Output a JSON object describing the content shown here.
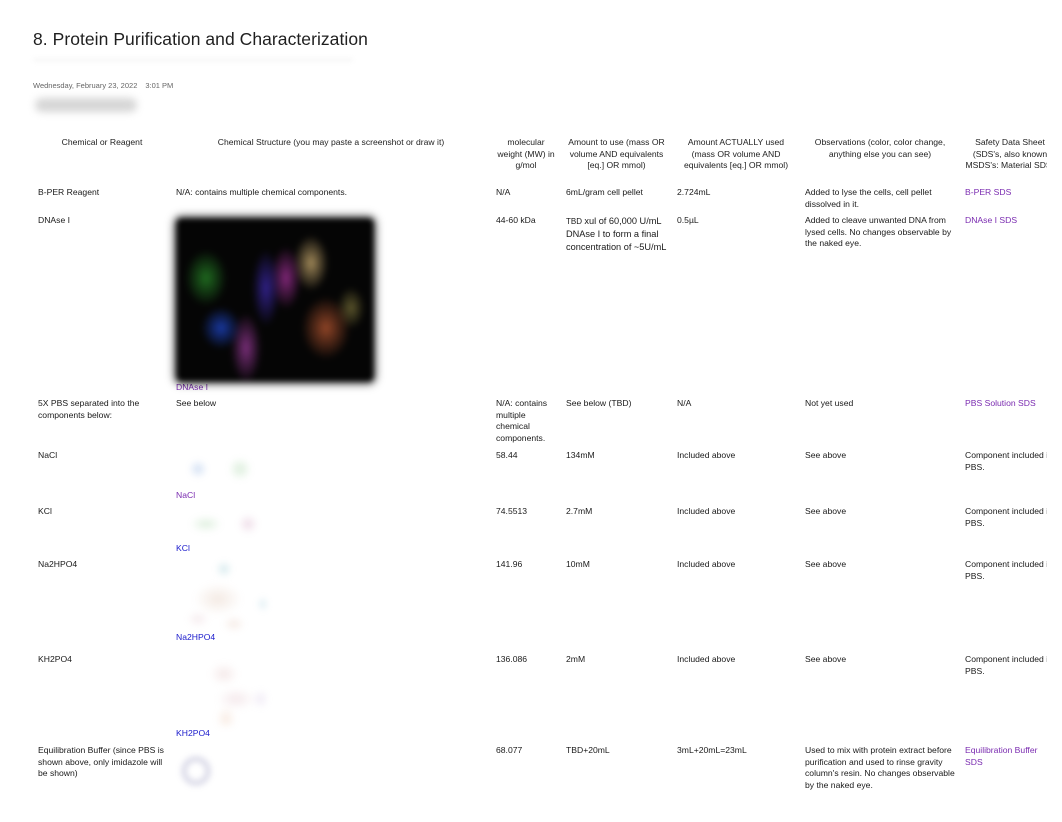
{
  "page": {
    "title": "8. Protein Purification and Characterization",
    "date": "Wednesday, February 23, 2022",
    "time": "3:01 PM"
  },
  "table": {
    "headers": [
      "Chemical or Reagent",
      "Chemical Structure (you may paste a screenshot or draw it)",
      "molecular weight (MW) in g/mol",
      "Amount to use (mass OR volume AND equivalents [eq.] OR mmol)",
      "Amount ACTUALLY used (mass OR volume AND equivalents [eq.] OR mmol)",
      "Observations (color, color change, anything else you can see)",
      "Safety Data Sheet (SDS's, also known MSDS's: Material SDS)"
    ],
    "rows": [
      {
        "reagent": "B-PER Reagent",
        "structure_text": "N/A: contains multiple chemical components.",
        "mw": "N/A",
        "amount_to_use": "6mL/gram cell pellet",
        "amount_used": "2.724mL",
        "observations": "Added to lyse the cells, cell pellet dissolved in it.",
        "sds": "B-PER SDS"
      },
      {
        "reagent": "DNAse I",
        "structure_image": "dnase-protein-structure",
        "structure_caption": "DNAse I",
        "mw": "44-60 kDa",
        "amount_to_use_prefix": "TBD",
        "amount_to_use": "xul of 60,000 U/mL DNAse I to form a final concentration of ~5U/mL",
        "amount_used": "0.5µL",
        "observations": "Added to cleave unwanted DNA from lysed cells. No changes observable by the naked eye.",
        "sds": "DNAse I SDS"
      },
      {
        "reagent": "5X PBS separated into the components below:",
        "structure_text": "See below",
        "mw": "N/A: contains multiple chemical components.",
        "amount_to_use": "See below (TBD)",
        "amount_used": "N/A",
        "observations": "Not yet used",
        "sds": "PBS Solution SDS"
      },
      {
        "reagent": "NaCl",
        "structure_image": "nacl-structure",
        "structure_caption": "NaCl",
        "mw": "58.44",
        "amount_to_use": "134mM",
        "amount_used": "Included above",
        "observations": "See above",
        "sds": "Component included in PBS."
      },
      {
        "reagent": "KCl",
        "structure_image": "kcl-structure",
        "structure_caption": "KCl",
        "mw": "74.5513",
        "amount_to_use": "2.7mM",
        "amount_used": "Included above",
        "observations": "See above",
        "sds": "Component included in PBS."
      },
      {
        "reagent": "Na2HPO4",
        "structure_image": "na2hpo4-structure",
        "structure_caption": "Na2HPO4",
        "mw": "141.96",
        "amount_to_use": "10mM",
        "amount_used": "Included above",
        "observations": "See above",
        "sds": "Component included in PBS."
      },
      {
        "reagent": "KH2PO4",
        "structure_image": "kh2po4-structure",
        "structure_caption": "KH2PO4",
        "mw": "136.086",
        "amount_to_use": "2mM",
        "amount_used": "Included above",
        "observations": "See above",
        "sds": "Component included in PBS."
      },
      {
        "reagent": "Equilibration Buffer (since PBS is shown above, only imidazole will be shown)",
        "structure_image": "imidazole-structure",
        "mw": "68.077",
        "amount_to_use": "TBD+20mL",
        "amount_used": "3mL+20mL=23mL",
        "observations": "Used to mix with protein extract before purification and used to rinse gravity column's resin. No changes observable by the naked eye.",
        "sds": "Equilibration Buffer SDS"
      }
    ]
  },
  "colors": {
    "visited_link": "#7a2bb0",
    "unvisited_link": "#1a1acc",
    "text": "#1a1a1a",
    "meta_text": "#666666"
  }
}
